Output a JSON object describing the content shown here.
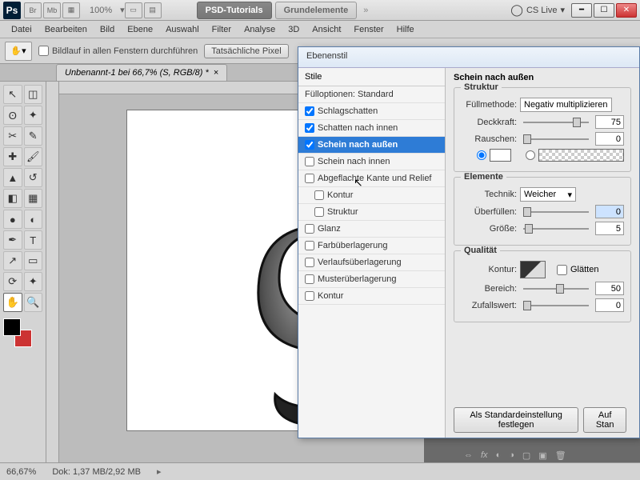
{
  "titlebar": {
    "ps": "Ps",
    "tray": [
      "Br",
      "Mb"
    ],
    "zoom": "100%",
    "tabs": [
      "PSD-Tutorials",
      "Grundelemente"
    ],
    "cslive": "CS Live"
  },
  "menu": [
    "Datei",
    "Bearbeiten",
    "Bild",
    "Ebene",
    "Auswahl",
    "Filter",
    "Analyse",
    "3D",
    "Ansicht",
    "Fenster",
    "Hilfe"
  ],
  "optbar": {
    "scroll_all": "Bildlauf in allen Fenstern durchführen",
    "actual_pixels": "Tatsächliche Pixel"
  },
  "doctab": "Unbenannt-1 bei 66,7% (S, RGB/8) *",
  "status": {
    "zoom": "66,67%",
    "doc": "Dok: 1,37 MB/2,92 MB"
  },
  "dialog": {
    "title": "Ebenenstil",
    "styles_header": "Stile",
    "blend_header": "Fülloptionen: Standard",
    "items": [
      {
        "label": "Schlagschatten",
        "checked": true
      },
      {
        "label": "Schatten nach innen",
        "checked": true
      },
      {
        "label": "Schein nach außen",
        "checked": true,
        "selected": true
      },
      {
        "label": "Schein nach innen",
        "checked": false
      },
      {
        "label": "Abgeflachte Kante und Relief",
        "checked": false
      },
      {
        "label": "Kontur",
        "checked": false,
        "indent": true
      },
      {
        "label": "Struktur",
        "checked": false,
        "indent": true
      },
      {
        "label": "Glanz",
        "checked": false
      },
      {
        "label": "Farbüberlagerung",
        "checked": false
      },
      {
        "label": "Verlaufsüberlagerung",
        "checked": false
      },
      {
        "label": "Musterüberlagerung",
        "checked": false
      },
      {
        "label": "Kontur",
        "checked": false
      }
    ],
    "right_title": "Schein nach außen",
    "struktur": "Struktur",
    "fullmethode_lbl": "Füllmethode:",
    "fullmethode_val": "Negativ multiplizieren",
    "deckkraft_lbl": "Deckkraft:",
    "deckkraft_val": "75",
    "rauschen_lbl": "Rauschen:",
    "rauschen_val": "0",
    "elemente": "Elemente",
    "technik_lbl": "Technik:",
    "technik_val": "Weicher",
    "uberfullen_lbl": "Überfüllen:",
    "uberfullen_val": "0",
    "grosse_lbl": "Größe:",
    "grosse_val": "5",
    "qualitat": "Qualität",
    "kontur_lbl": "Kontur:",
    "glatten_lbl": "Glätten",
    "bereich_lbl": "Bereich:",
    "bereich_val": "50",
    "zufall_lbl": "Zufallswert:",
    "zufall_val": "0",
    "default_btn": "Als Standardeinstellung festlegen",
    "reset_btn": "Auf Stan"
  }
}
